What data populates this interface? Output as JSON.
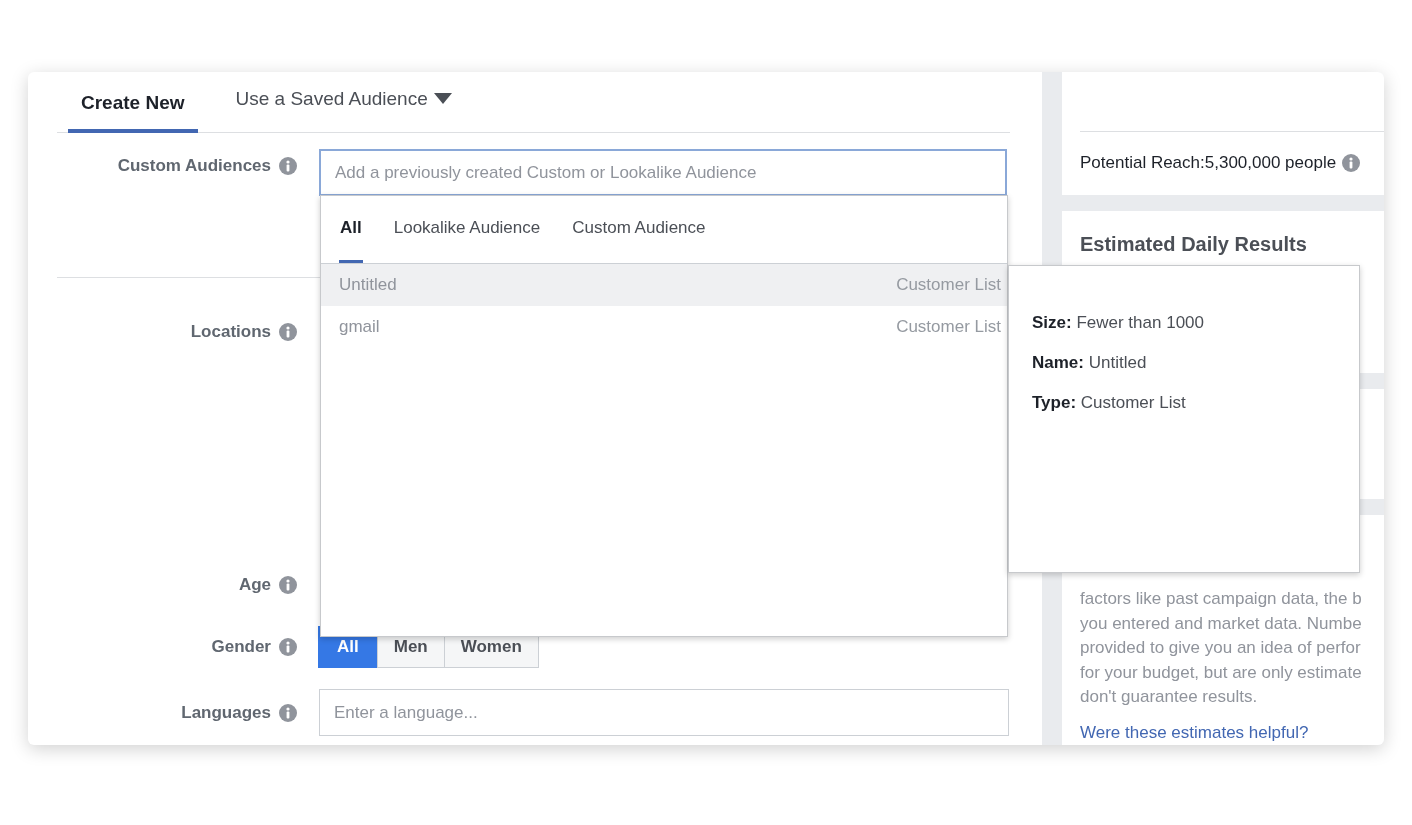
{
  "audience_tabs": [
    {
      "label": "Create New",
      "kind": "tab",
      "selected": true
    },
    {
      "label": "Use a Saved Audience",
      "kind": "dropdown",
      "selected": false
    }
  ],
  "fields": [
    {
      "label": "Custom Audiences",
      "kind": "audience",
      "placeholder": "Add a previously created Custom or Lookalike Audience",
      "focused": true
    },
    {
      "label": "Locations",
      "kind": "covered"
    },
    {
      "label": "Age",
      "kind": "covered"
    },
    {
      "label": "Gender",
      "kind": "segmented",
      "options": [
        {
          "label": "All",
          "selected": true
        },
        {
          "label": "Men",
          "selected": false
        },
        {
          "label": "Women",
          "selected": false
        }
      ]
    },
    {
      "label": "Languages",
      "kind": "text",
      "placeholder": "Enter a language..."
    }
  ],
  "audience_menu": {
    "tabs": [
      {
        "label": "All",
        "selected": true
      },
      {
        "label": "Lookalike Audience",
        "selected": false
      },
      {
        "label": "Custom Audience",
        "selected": false
      }
    ],
    "items": [
      {
        "name": "Untitled",
        "type": "Customer List",
        "highlighted": true
      },
      {
        "name": "gmail",
        "type": "Customer List",
        "highlighted": false
      }
    ]
  },
  "audience_tooltip": {
    "rows": [
      "**Size:** Fewer than 1000",
      "**Name:** Untitled",
      "**Type:** Customer List"
    ]
  },
  "right_panel": {
    "potential_reach": "Potential Reach:5,300,000 people",
    "estimated_title": "Estimated Daily Results",
    "disclaimer": "factors like past campaign data, the b\nyou entered and market data. Numbe\nprovided to give you an idea of perfor\nfor your budget, but are only estimate\ndon't guarantee results.",
    "feedback_link": "Were these estimates helpful?"
  }
}
